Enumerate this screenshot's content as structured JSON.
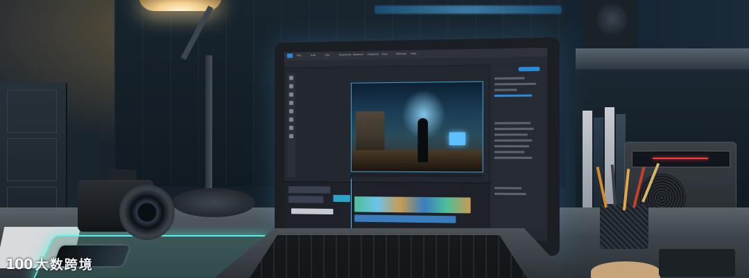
{
  "scene": {
    "description_tags": [
      "desk-setup",
      "laptop",
      "video-editor",
      "camera",
      "lamp"
    ]
  },
  "editor": {
    "menu": [
      "File",
      "Edit",
      "Clip",
      "Sequence",
      "Markers",
      "Graphics",
      "View",
      "Window",
      "Help"
    ],
    "accent_color": "#2b8ad8",
    "selection_color": "#3fa0d6",
    "timeline_track_colors": [
      "#2aa4c8",
      "#4fbf9a",
      "#6cc3e8",
      "#c99b52",
      "#3a7dbf"
    ]
  },
  "laptop": {
    "brand_label": ""
  },
  "watermark": {
    "logo": "100",
    "text": "大数跨境"
  }
}
